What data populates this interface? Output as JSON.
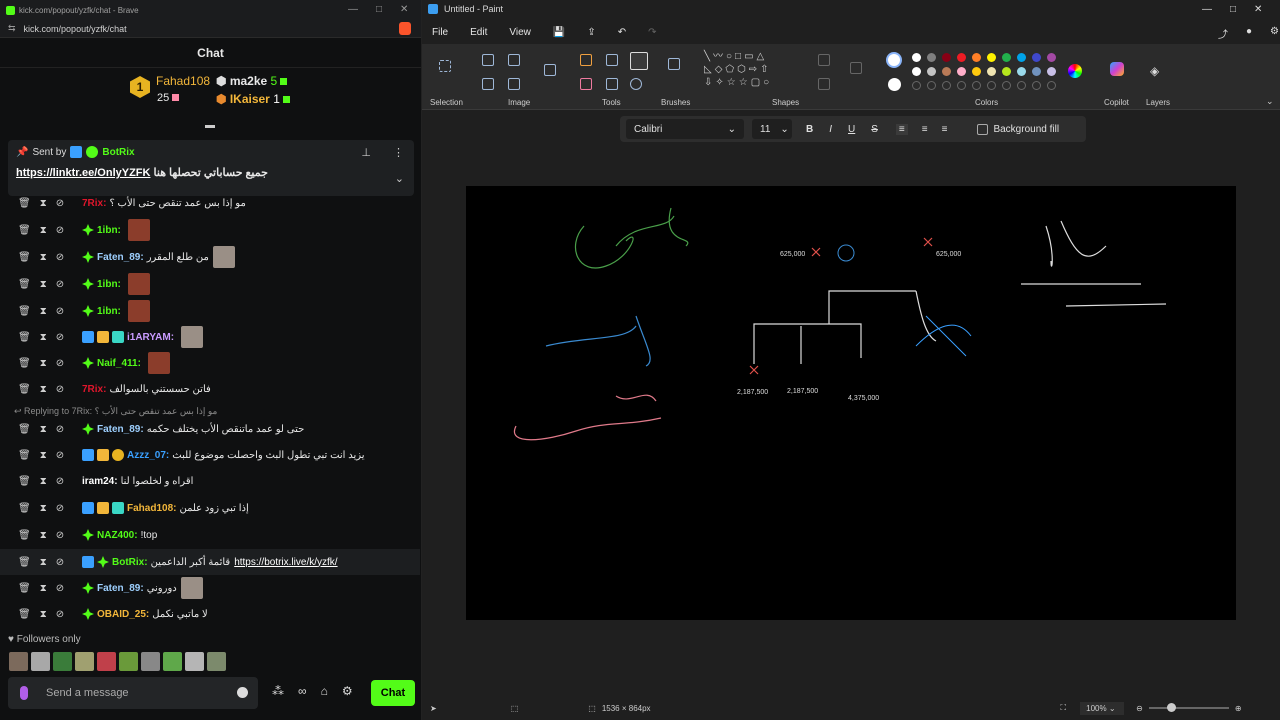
{
  "browser": {
    "title": "kick.com/popout/yzfk/chat - Brave",
    "url": "kick.com/popout/yzfk/chat"
  },
  "chat": {
    "header": "Chat",
    "leaderboard": [
      {
        "name": "Fahad108",
        "count": "25",
        "rank": "1"
      },
      {
        "name": "ma2ke",
        "count": "5"
      },
      {
        "name": "IKaiser",
        "count": "1"
      }
    ],
    "pinned": {
      "sent_by_label": "Sent by",
      "author": "BotRix",
      "text": "جميع حساباتي تحصلها هنا",
      "link": "https://linktr.ee/OnlyYZFK"
    },
    "messages": [
      {
        "user": "7Rix",
        "color": "#e0162c",
        "text": "مو إذا بس عمد تنقص حتى الأب ؟"
      },
      {
        "user": "1ibn",
        "color": "#53fc18",
        "text": ""
      },
      {
        "user": "Faten_89",
        "color": "#9ed0ff",
        "text": "من طلع المقرر"
      },
      {
        "user": "1ibn",
        "color": "#53fc18",
        "text": ""
      },
      {
        "user": "1ibn",
        "color": "#53fc18",
        "text": ""
      },
      {
        "user": "i1ARYAM",
        "color": "#c99bff",
        "text": ""
      },
      {
        "user": "Naif_411",
        "color": "#53fc18",
        "text": ""
      },
      {
        "user": "7Rix",
        "color": "#e0162c",
        "text": "فاتن حسستني بالسوالف"
      },
      {
        "user": "Faten_89",
        "color": "#9ed0ff",
        "text": "حتى لو عمد ماتنقص الأب يختلف حكمه"
      },
      {
        "user": "Azzz_07",
        "color": "#3aa0ff",
        "text": "يزيد انت تبي تطول البث واحصلت موضوع للبث"
      },
      {
        "user": "iram24",
        "color": "#ffffff",
        "text": "اقراه و لخلصوا لنا"
      },
      {
        "user": "Fahad108",
        "color": "#f2b63a",
        "text": "إذا تبي زود علمن"
      },
      {
        "user": "NAZ400",
        "color": "#53fc18",
        "text": "!top"
      },
      {
        "user": "BotRix",
        "color": "#53fc18",
        "text": "قائمة أكبر الداعمين",
        "link": "https://botrix.live/k/yzfk/"
      },
      {
        "user": "Faten_89",
        "color": "#9ed0ff",
        "text": "دوروني"
      },
      {
        "user": "OBAID_25",
        "color": "#f2b63a",
        "text": "لا ماتبي نكمل"
      }
    ],
    "reply_label": "Replying to 7Rix:",
    "reply_text": "مو إذا بس عمد تنقص حتى الأب ؟",
    "followers_only": "Followers only",
    "composer_placeholder": "Send a message",
    "chat_button": "Chat"
  },
  "paint": {
    "title": "Untitled - Paint",
    "menu": [
      "File",
      "Edit",
      "View"
    ],
    "groups": [
      "Selection",
      "Image",
      "Tools",
      "Brushes",
      "Shapes",
      "Colors",
      "Copilot",
      "Layers"
    ],
    "font": "Calibri",
    "font_size": "11",
    "format_buttons": [
      "B",
      "I",
      "U",
      "S"
    ],
    "background_fill": "Background fill",
    "canvas_size": "1536 × 864px",
    "zoom": "100%",
    "canvas_labels": [
      "625,000",
      "625,000",
      "2,187,500",
      "2,187,500",
      "4,375,000"
    ],
    "palette": [
      "#ffffff",
      "#7f7f7f",
      "#880015",
      "#ed1c24",
      "#ff7f27",
      "#fff200",
      "#22b14c",
      "#00a2e8",
      "#3f48cc",
      "#a349a4",
      "#ffffff",
      "#c3c3c3",
      "#b97a57",
      "#ffaec9",
      "#ffc90e",
      "#efe4b0",
      "#b5e61d",
      "#99d9ea",
      "#7092be",
      "#c8bfe7"
    ]
  }
}
